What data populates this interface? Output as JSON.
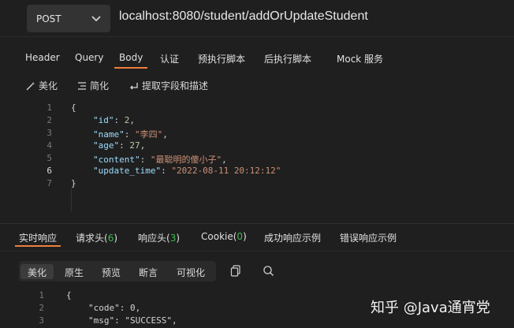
{
  "request": {
    "method": "POST",
    "url": "localhost:8080/student/addOrUpdateStudent"
  },
  "tabs": [
    {
      "label": "Header"
    },
    {
      "label": "Query"
    },
    {
      "label": "Body",
      "active": true
    },
    {
      "label": "认证"
    },
    {
      "label": "预执行脚本"
    },
    {
      "label": "后执行脚本"
    },
    {
      "label": "Mock 服务"
    }
  ],
  "tools": {
    "beautify": "美化",
    "simplify": "简化",
    "extract": "提取字段和描述"
  },
  "body_code": {
    "line_numbers": [
      "1",
      "2",
      "3",
      "4",
      "5",
      "6",
      "7"
    ],
    "open_brace": "{",
    "close_brace": "}",
    "fields": [
      {
        "key": "\"id\"",
        "value": "2",
        "type": "number"
      },
      {
        "key": "\"name\"",
        "value": "\"李四\"",
        "type": "string"
      },
      {
        "key": "\"age\"",
        "value": "27",
        "type": "number"
      },
      {
        "key": "\"content\"",
        "value": "\"最聪明的傻小子\"",
        "type": "string"
      },
      {
        "key": "\"update_time\"",
        "value": "\"2022-08-11 20:12:12\"",
        "type": "string"
      }
    ]
  },
  "response_tabs": {
    "realtime": "实时响应",
    "req_headers": "请求头",
    "req_headers_count": "6",
    "resp_headers": "响应头",
    "resp_headers_count": "3",
    "cookie": "Cookie",
    "cookie_count": "0",
    "success_example": "成功响应示例",
    "error_example": "错误响应示例"
  },
  "view_modes": [
    "美化",
    "原生",
    "预览",
    "断言",
    "可视化"
  ],
  "response_code": {
    "line_numbers": [
      "1",
      "2",
      "3"
    ],
    "open_brace": "{",
    "code_key": "\"code\"",
    "code_val": "0",
    "msg_key": "\"msg\"",
    "msg_val": "\"SUCCESS\""
  },
  "watermark": "知乎 @Java通宵党",
  "colors": {
    "accent": "#f07d3c",
    "count_green": "#3fb950",
    "json_key": "#9cdcfe",
    "json_string": "#ce9178",
    "json_number": "#b5cea8"
  }
}
